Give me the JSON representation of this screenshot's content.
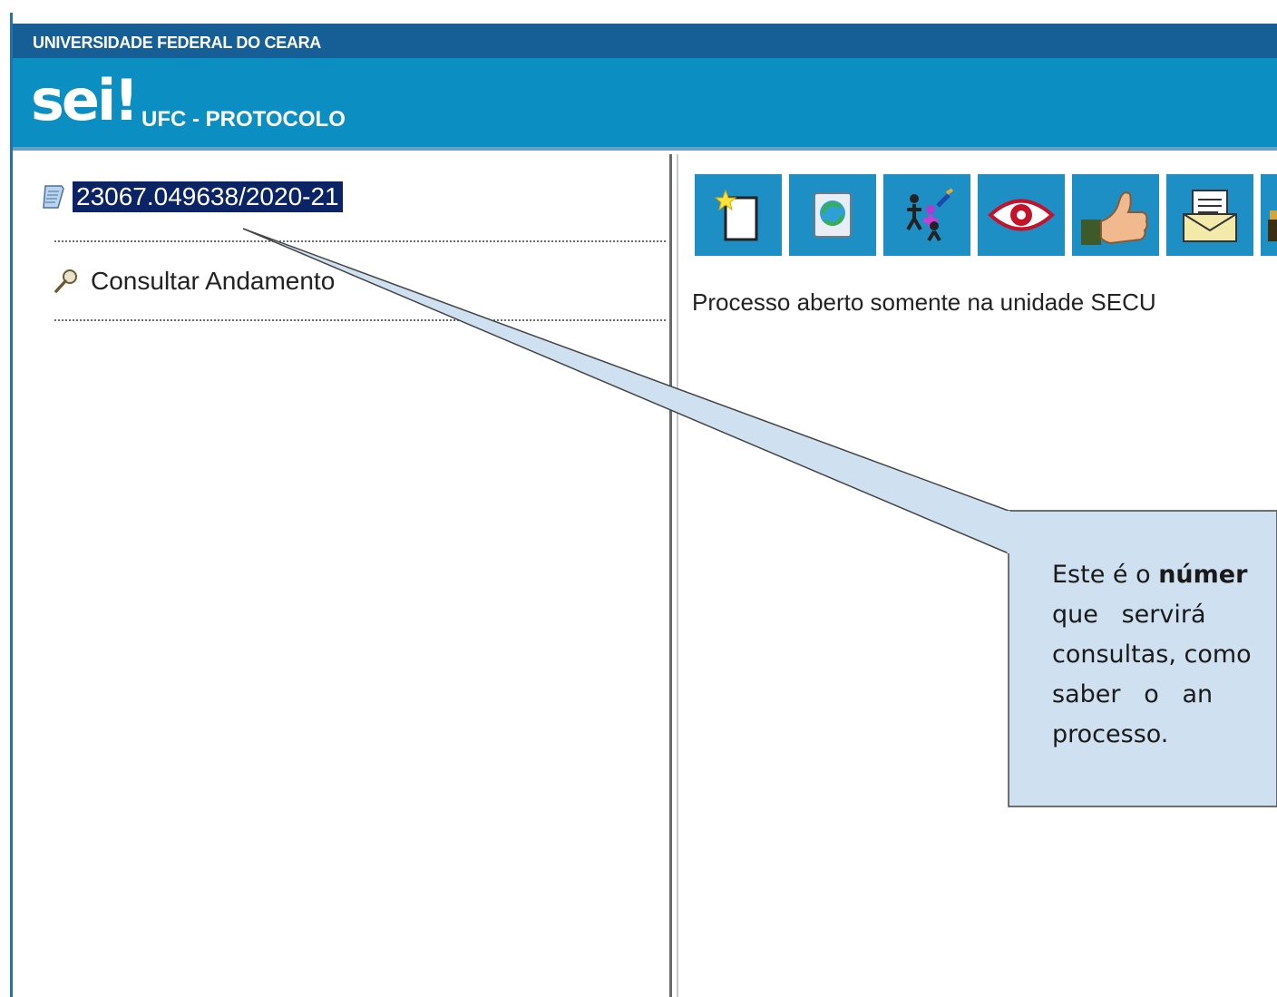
{
  "header": {
    "organization": "UNIVERSIDADE FEDERAL DO CEARA",
    "logo": "sei!",
    "unit": "UFC - PROTOCOLO"
  },
  "tree": {
    "process_number": "23067.049638/2020-21",
    "process_icon": "document-icon",
    "consult_label": "Consultar Andamento",
    "consult_icon": "magnifier-icon"
  },
  "toolbar": {
    "buttons": [
      {
        "icon": "new-document-icon"
      },
      {
        "icon": "refresh-process-icon"
      },
      {
        "icon": "assign-users-icon"
      },
      {
        "icon": "view-eye-icon"
      },
      {
        "icon": "thumbs-up-icon"
      },
      {
        "icon": "envelope-icon"
      },
      {
        "icon": "partial-tool-icon"
      }
    ]
  },
  "status": {
    "text": "Processo aberto somente na unidade SECU"
  },
  "callout": {
    "line1_prefix": "Este é o ",
    "line1_bold": "númer",
    "line2": "que   servirá",
    "line3": "consultas, como",
    "line4": "saber   o   an",
    "line5": "processo."
  },
  "colors": {
    "top_bar": "#155e96",
    "header": "#0b8fc2",
    "selection": "#0b2466",
    "toolbar_button": "#1e8fc4",
    "callout_fill": "#cfe0f1"
  }
}
